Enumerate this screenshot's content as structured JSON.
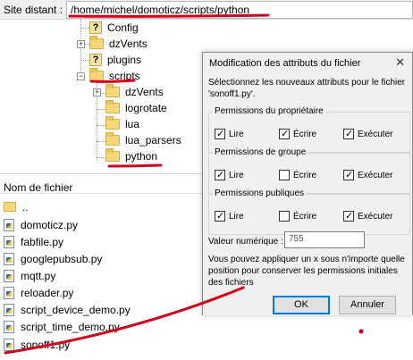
{
  "pathbar": {
    "label": "Site distant :",
    "value": "/home/michel/domoticz/scripts/python"
  },
  "tree": {
    "items": [
      {
        "label": "Config",
        "icon": "unknown-folder-icon"
      },
      {
        "label": "dzVents",
        "icon": "folder-icon"
      },
      {
        "label": "plugins",
        "icon": "unknown-folder-icon"
      },
      {
        "label": "scripts",
        "icon": "folder-icon"
      },
      {
        "label": "dzVents",
        "icon": "folder-icon"
      },
      {
        "label": "logrotate",
        "icon": "folder-icon"
      },
      {
        "label": "lua",
        "icon": "folder-icon"
      },
      {
        "label": "lua_parsers",
        "icon": "folder-icon"
      },
      {
        "label": "python",
        "icon": "folder-icon"
      }
    ]
  },
  "filelist": {
    "column_header": "Nom de fichier",
    "files": [
      "..",
      "domoticz.py",
      "fabfile.py",
      "googlepubsub.py",
      "mqtt.py",
      "reloader.py",
      "script_device_demo.py",
      "script_time_demo.py",
      "sonoff1.py"
    ]
  },
  "dialog": {
    "title": "Modification des attributs du fichier",
    "intro": "Sélectionnez les nouveaux attributs pour le fichier 'sonoff1.py'.",
    "groups": [
      {
        "title": "Permissions du propriétaire",
        "perms": [
          {
            "label": "Lire",
            "checked": true
          },
          {
            "label": "Écrire",
            "checked": true
          },
          {
            "label": "Exécuter",
            "checked": true
          }
        ]
      },
      {
        "title": "Permissions de groupe",
        "perms": [
          {
            "label": "Lire",
            "checked": true
          },
          {
            "label": "Écrire",
            "checked": false
          },
          {
            "label": "Exécuter",
            "checked": true
          }
        ]
      },
      {
        "title": "Permissions publiques",
        "perms": [
          {
            "label": "Lire",
            "checked": true
          },
          {
            "label": "Écrire",
            "checked": false
          },
          {
            "label": "Exécuter",
            "checked": true
          }
        ]
      }
    ],
    "numeric_label": "Valeur numérique :",
    "numeric_value": "755",
    "note": "Vous pouvez appliquer un x sous n'importe quelle position pour conserver les permissions initiales des fichiers",
    "ok_label": "OK",
    "cancel_label": "Annuler"
  },
  "colors": {
    "annotation": "#d0021b",
    "folder": "#f5d679"
  }
}
